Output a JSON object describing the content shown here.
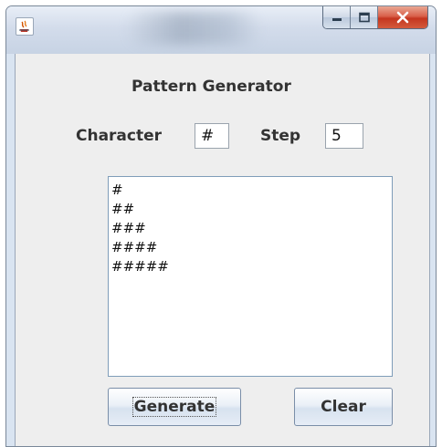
{
  "window": {
    "title": "",
    "app_icon": "java-coffee-cup-icon",
    "controls": [
      "minimize-icon",
      "maximize-icon",
      "close-icon"
    ]
  },
  "form": {
    "title": "Pattern Generator",
    "character_label": "Character",
    "character_value": "#",
    "step_label": "Step",
    "step_value": "5"
  },
  "output": {
    "lines": [
      "#",
      "##",
      "###",
      "####",
      "#####"
    ]
  },
  "buttons": {
    "generate_label": "Generate",
    "clear_label": "Clear"
  }
}
